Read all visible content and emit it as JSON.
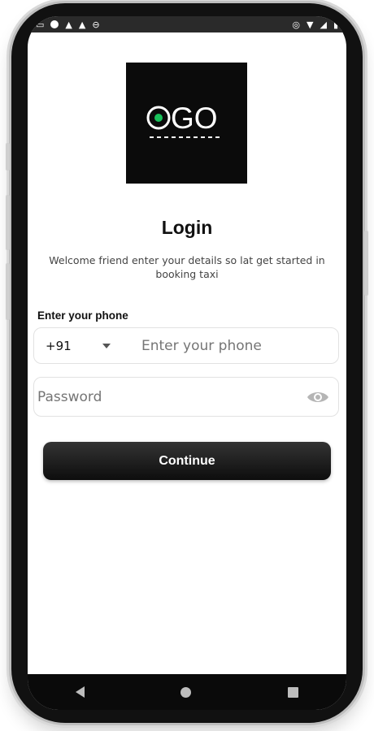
{
  "status_bar": {
    "icons_left": [
      "cast-icon",
      "record-icon",
      "notification-icon",
      "notification-icon",
      "db-icon"
    ],
    "icons_right": [
      "location-icon",
      "wifi-icon",
      "signal-icon",
      "battery-icon"
    ]
  },
  "logo": {
    "text": "OGO",
    "dot_color": "#19c15a"
  },
  "login": {
    "title": "Login",
    "subtitle": "Welcome friend enter your details so lat get started in booking taxi",
    "phone_label": "Enter your phone",
    "country_code": "+91",
    "phone_placeholder": "Enter your phone",
    "password_placeholder": "Password",
    "continue_label": "Continue"
  },
  "colors": {
    "accent": "#111111",
    "border": "#e2e2e2"
  }
}
